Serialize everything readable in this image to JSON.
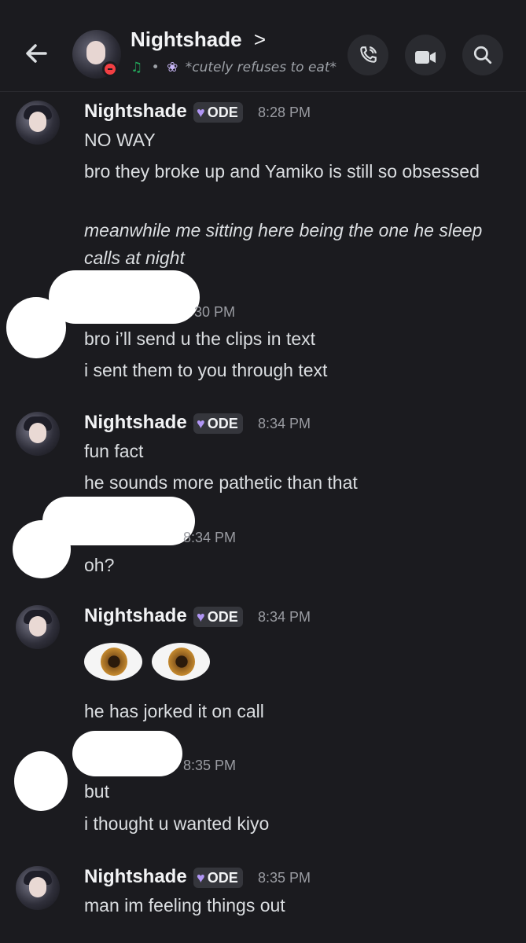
{
  "header": {
    "back_icon": "arrow-left-icon",
    "name": "Nightshade",
    "chevron": ">",
    "status_music_icon": "♫",
    "status_separator": "•",
    "status_flower_icon": "❀",
    "status_text": "*cutely refuses to eat*",
    "call_icon": "phone-icon",
    "video_icon": "video-icon",
    "search_icon": "search-icon"
  },
  "messages": [
    {
      "author": "Nightshade",
      "tag": "ODE",
      "time": "8:28 PM",
      "lines": [
        "NO WAY",
        "bro they broke up and Yamiko is still so obsessed",
        "meanwhile me sitting here being the one he sleep calls at night"
      ]
    },
    {
      "author": "",
      "time_visible": "30 PM",
      "lines": [
        "bro i’ll send u the clips in text",
        "i sent them to you through text"
      ]
    },
    {
      "author": "Nightshade",
      "tag": "ODE",
      "time": "8:34 PM",
      "lines": [
        "fun fact",
        "he sounds more pathetic than that"
      ]
    },
    {
      "author": "",
      "time": "8:34 PM",
      "lines": [
        "oh?"
      ]
    },
    {
      "author": "Nightshade",
      "tag": "ODE",
      "time": "8:34 PM",
      "emoji": "👀",
      "lines": [
        "he has jorked it on call"
      ]
    },
    {
      "author": "",
      "time": "8:35 PM",
      "lines": [
        "but",
        "i thought u wanted kiyo"
      ]
    },
    {
      "author": "Nightshade",
      "tag": "ODE",
      "time": "8:35 PM",
      "lines": [
        "man im feeling things out"
      ]
    }
  ]
}
